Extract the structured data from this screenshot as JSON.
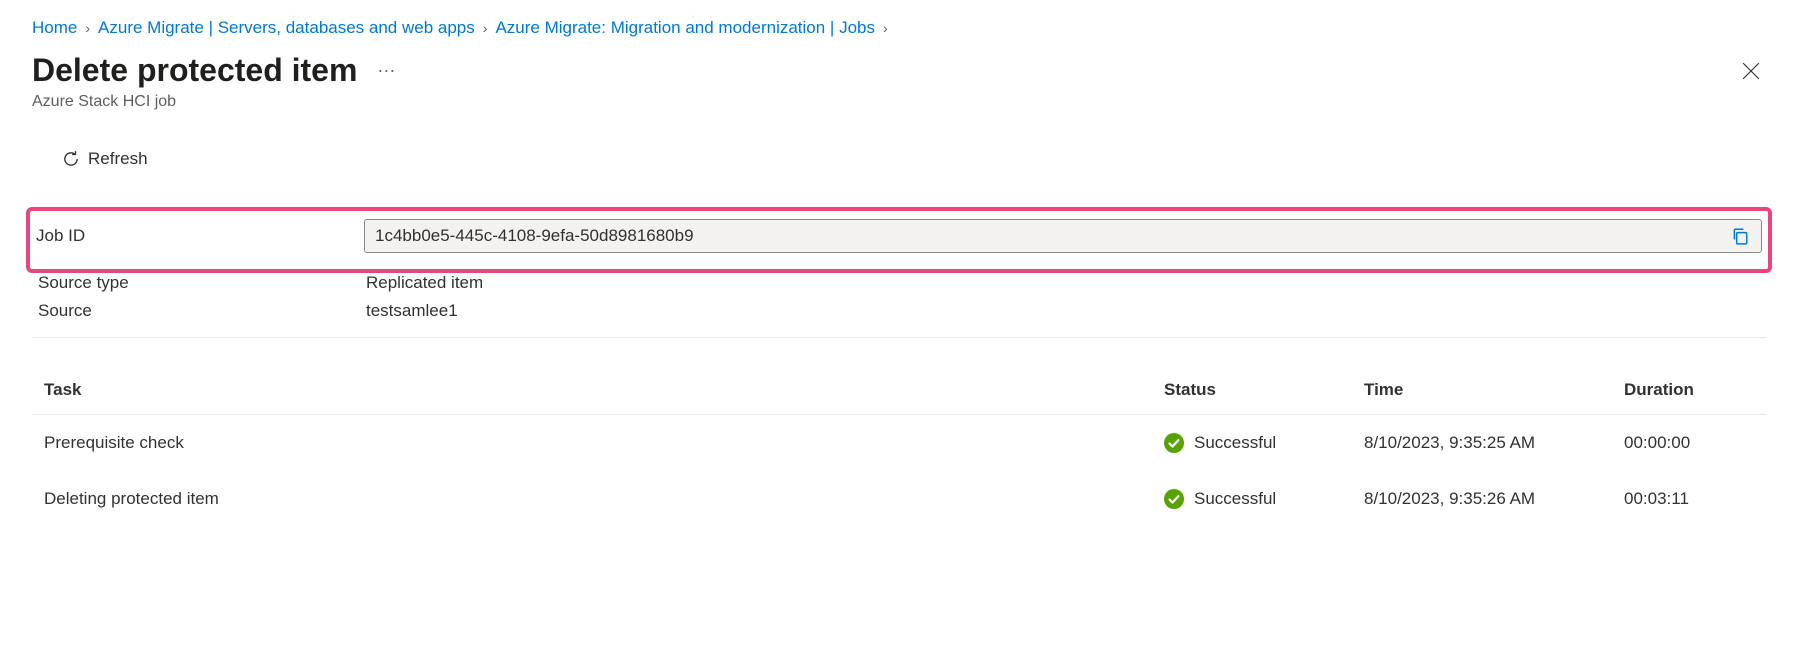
{
  "breadcrumb": {
    "items": [
      {
        "label": "Home"
      },
      {
        "label": "Azure Migrate | Servers, databases and web apps"
      },
      {
        "label": "Azure Migrate: Migration and modernization | Jobs"
      }
    ]
  },
  "header": {
    "title": "Delete protected item",
    "subtitle": "Azure Stack HCI job"
  },
  "toolbar": {
    "refresh_label": "Refresh"
  },
  "properties": {
    "jobid_label": "Job ID",
    "jobid_value": "1c4bb0e5-445c-4108-9efa-50d8981680b9",
    "source_type_label": "Source type",
    "source_type_value": "Replicated item",
    "source_label": "Source",
    "source_value": "testsamlee1"
  },
  "table": {
    "headers": {
      "task": "Task",
      "status": "Status",
      "time": "Time",
      "duration": "Duration"
    },
    "rows": [
      {
        "task": "Prerequisite check",
        "status": "Successful",
        "time": "8/10/2023, 9:35:25 AM",
        "duration": "00:00:00"
      },
      {
        "task": "Deleting protected item",
        "status": "Successful",
        "time": "8/10/2023, 9:35:26 AM",
        "duration": "00:03:11"
      }
    ]
  }
}
